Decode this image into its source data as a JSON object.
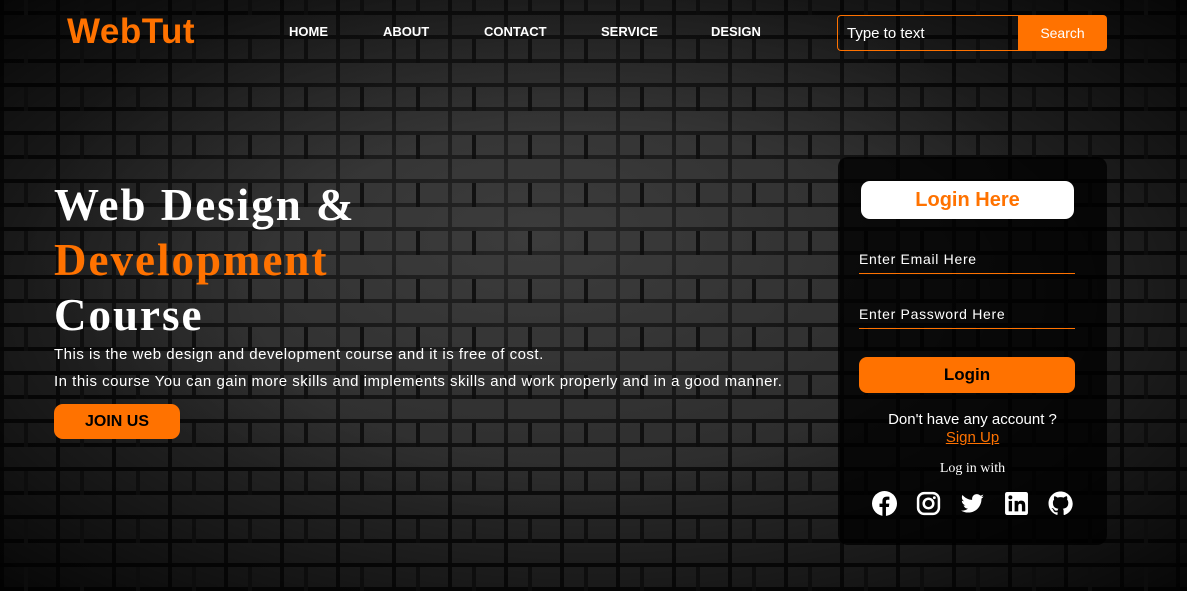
{
  "logo": "WebTut",
  "nav": [
    "HOME",
    "ABOUT",
    "CONTACT",
    "SERVICE",
    "DESIGN"
  ],
  "search": {
    "placeholder": "Type to text",
    "button": "Search"
  },
  "hero": {
    "line1": "Web Design &",
    "line2": "Development",
    "line3": "Course",
    "desc1": "This is the web design and development course and it is free of cost.",
    "desc2": "In this course You can gain more skills and implements skills and work properly and in a good manner.",
    "cta": "JOIN US"
  },
  "login": {
    "title": "Login Here",
    "email_placeholder": "Enter Email Here",
    "password_placeholder": "Enter Password Here",
    "button": "Login",
    "no_account": "Don't have any account ?",
    "signup": "Sign Up",
    "log_in_with": "Log in with",
    "social_icons": [
      "facebook-icon",
      "instagram-icon",
      "twitter-icon",
      "linkedin-icon",
      "github-icon"
    ]
  },
  "colors": {
    "accent": "#ff7200",
    "text": "#ffffff"
  }
}
